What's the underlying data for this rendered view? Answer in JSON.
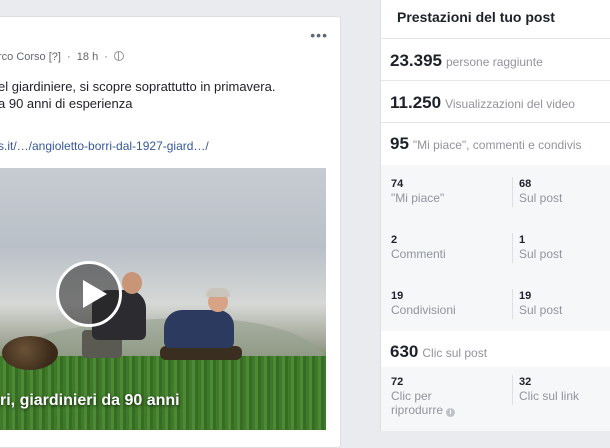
{
  "post": {
    "author": "rco Corso",
    "author_tag": "[?]",
    "time": "18 h",
    "menu_icon": "ellipsis-icon",
    "text_lines": [
      "el giardiniere, si scopre soprattutto in primavera.",
      "a 90 anni di esperienza"
    ],
    "link": "s.it/…/angioletto-borri-dal-1927-giard…/",
    "video": {
      "play_icon": "play-icon",
      "caption": "ri, giardinieri da 90 anni"
    }
  },
  "insights": {
    "title": "Prestazioni del tuo post",
    "reach": {
      "value": "23.395",
      "label": "persone raggiunte"
    },
    "views": {
      "value": "11.250",
      "label": "Visualizzazioni del video"
    },
    "engagement": {
      "value": "95",
      "label": "\"Mi piace\", commenti e condivis"
    },
    "breakdown": [
      {
        "left_num": "74",
        "left_label": "\"Mi piace\"",
        "right_num": "68",
        "right_label": "Sul post"
      },
      {
        "left_num": "2",
        "left_label": "Commenti",
        "right_num": "1",
        "right_label": "Sul post"
      },
      {
        "left_num": "19",
        "left_label": "Condivisioni",
        "right_num": "19",
        "right_label": "Sul post"
      }
    ],
    "clicks": {
      "value": "630",
      "label": "Clic sul post"
    },
    "click_breakdown": {
      "left_num": "72",
      "left_label_1": "Clic per",
      "left_label_2": "riprodurre",
      "info_icon": "info-icon",
      "right_num": "32",
      "right_label": "Clic sul link"
    }
  }
}
